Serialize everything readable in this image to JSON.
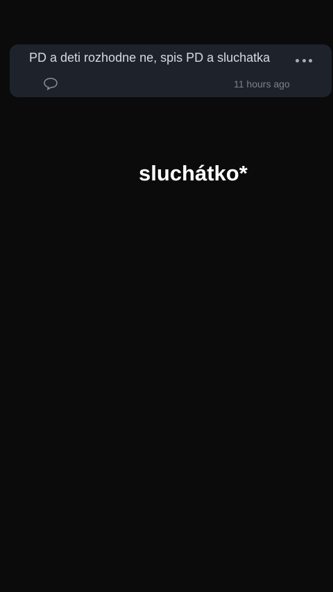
{
  "comment": {
    "text": "PD a deti rozhodne ne, spis PD a sluchatka",
    "time": "11 hours ago",
    "icons": {
      "more": "more-dots-icon",
      "reply": "speech-bubble-icon"
    }
  },
  "overlay": {
    "text": "sluchátko*"
  },
  "colors": {
    "background": "#0b0b0c",
    "card": "#1e232b",
    "text": "#d6dae0",
    "muted": "#7b818a",
    "overlay_text": "#ffffff"
  }
}
